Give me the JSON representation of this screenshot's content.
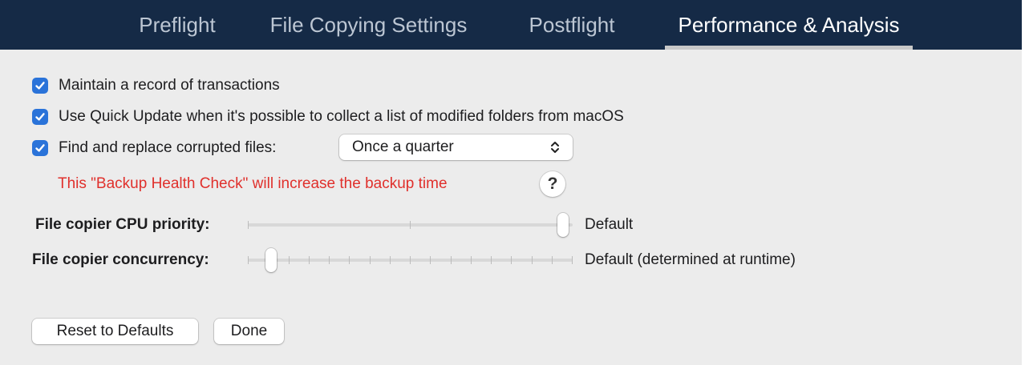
{
  "tabs": [
    {
      "label": "Preflight",
      "active": false
    },
    {
      "label": "File Copying Settings",
      "active": false
    },
    {
      "label": "Postflight",
      "active": false
    },
    {
      "label": "Performance & Analysis",
      "active": true
    }
  ],
  "options": {
    "record_transactions": {
      "label": "Maintain a record of transactions",
      "checked": true
    },
    "quick_update": {
      "label": "Use Quick Update when it's possible to collect a list of modified folders from macOS",
      "checked": true
    },
    "replace_corrupted": {
      "label": "Find and replace corrupted files:",
      "checked": true
    }
  },
  "frequency_popup": {
    "selected": "Once a quarter"
  },
  "health_warning": "This \"Backup Health Check\" will increase the backup time",
  "help_button": {
    "label": "?"
  },
  "cpu_priority": {
    "label": "File copier CPU priority:",
    "value_text": "Default",
    "position": 1.0
  },
  "concurrency": {
    "label": "File copier concurrency:",
    "value_text": "Default (determined at runtime)",
    "position": 0.0
  },
  "buttons": {
    "reset": "Reset to Defaults",
    "done": "Done"
  },
  "colors": {
    "tabbar_bg": "#152a46",
    "checkbox_blue": "#2a73d9",
    "warning_red": "#e0302c"
  },
  "icons": {
    "checkbox": "checkmark-icon",
    "popup": "up-down-chevron-icon"
  }
}
